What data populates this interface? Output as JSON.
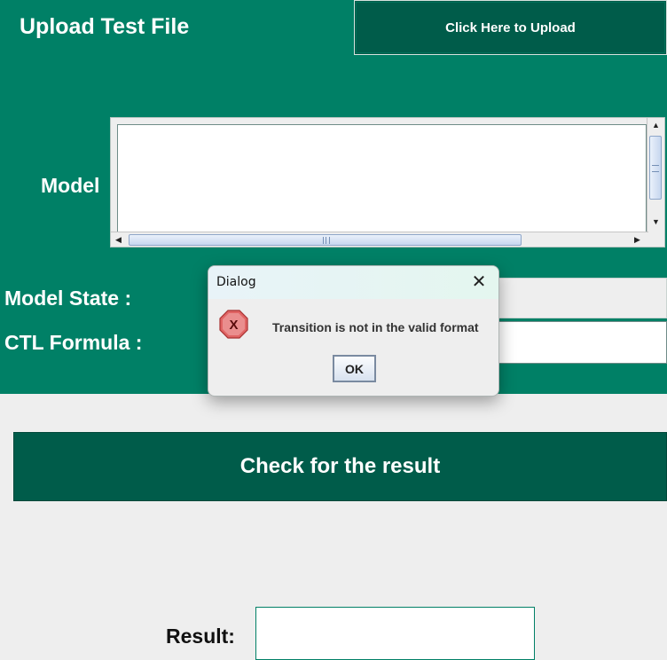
{
  "upload": {
    "title": "Upload Test File",
    "button_label": "Click Here to Upload"
  },
  "model": {
    "label": "Model",
    "text": "",
    "scroll_up_icon": "triangle-up-icon",
    "scroll_down_icon": "triangle-down-icon",
    "scroll_left_icon": "triangle-left-icon",
    "scroll_right_icon": "triangle-right-icon"
  },
  "model_state": {
    "label": "Model State :",
    "value": ""
  },
  "ctl_formula": {
    "label": "CTL Formula :",
    "value": ""
  },
  "check": {
    "button_label": "Check for the result"
  },
  "result": {
    "label": "Result:",
    "value": ""
  },
  "dialog": {
    "title": "Dialog",
    "close_glyph": "✕",
    "message": "Transition is not in the valid format",
    "ok_label": "OK",
    "icon": "error-icon"
  },
  "colors": {
    "panel": "#008066",
    "button": "#005c4a",
    "background": "#eeeeee",
    "error": "#d94c4c"
  }
}
